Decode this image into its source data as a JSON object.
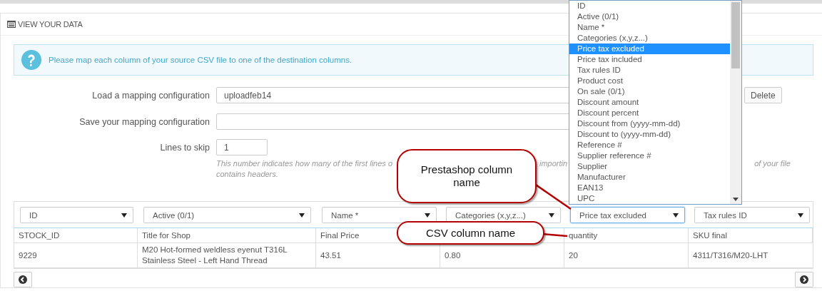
{
  "panel": {
    "title": "VIEW YOUR DATA"
  },
  "alert": {
    "text": "Please map each column of your source CSV file to one of the destination columns."
  },
  "form": {
    "load": {
      "label": "Load a mapping configuration",
      "value": "uploadfeb14",
      "button": "Delete"
    },
    "save": {
      "label": "Save your mapping configuration"
    },
    "skip": {
      "label": "Lines to skip",
      "value": "1"
    },
    "hint": {
      "line_1_parts": [
        "This number indicates how many of the first lines o",
        "importin",
        "of your file"
      ],
      "line_2": "contains headers."
    }
  },
  "table": {
    "columns": [
      {
        "select": "ID",
        "focused": false,
        "header": "STOCK_ID",
        "cells": [
          "9229"
        ]
      },
      {
        "select": "Active (0/1)",
        "focused": false,
        "header": "Title for Shop",
        "cells": [
          "M20 Hot-formed weldless eyenut T316L Stainless Steel - Left Hand Thread"
        ]
      },
      {
        "select": "Name *",
        "focused": false,
        "header": "Final Price",
        "cells": [
          "43.51"
        ]
      },
      {
        "select": "Categories (x,y,z...)",
        "focused": false,
        "cells": [
          "0.80"
        ]
      },
      {
        "select": "Price tax excluded",
        "focused": true,
        "header": "quantity",
        "cells": [
          "20"
        ]
      },
      {
        "select": "Tax rules ID",
        "focused": false,
        "header": "SKU final",
        "cells": [
          "4311/T316/M20-LHT"
        ]
      }
    ]
  },
  "dropdown": {
    "options": [
      {
        "label": "ID",
        "selected": false
      },
      {
        "label": "Active (0/1)",
        "selected": false
      },
      {
        "label": "Name *",
        "selected": false
      },
      {
        "label": "Categories (x,y,z...)",
        "selected": false
      },
      {
        "label": "Price tax excluded",
        "selected": true
      },
      {
        "label": "Price tax included",
        "selected": false
      },
      {
        "label": "Tax rules ID",
        "selected": false
      },
      {
        "label": "Product cost",
        "selected": false
      },
      {
        "label": "On sale (0/1)",
        "selected": false
      },
      {
        "label": "Discount amount",
        "selected": false
      },
      {
        "label": "Discount percent",
        "selected": false
      },
      {
        "label": "Discount from (yyyy-mm-dd)",
        "selected": false
      },
      {
        "label": "Discount to (yyyy-mm-dd)",
        "selected": false
      },
      {
        "label": "Reference #",
        "selected": false
      },
      {
        "label": "Supplier reference #",
        "selected": false
      },
      {
        "label": "Supplier",
        "selected": false
      },
      {
        "label": "Manufacturer",
        "selected": false
      },
      {
        "label": "EAN13",
        "selected": false
      },
      {
        "label": "UPC",
        "selected": false
      }
    ]
  },
  "callouts": [
    {
      "text": "Prestashop column name",
      "kind": "tall"
    },
    {
      "text": "CSV column name",
      "kind": "wide"
    }
  ]
}
